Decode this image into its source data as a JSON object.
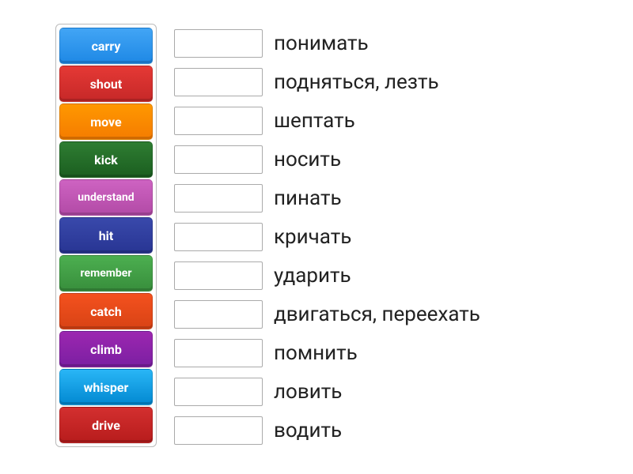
{
  "word_bank": [
    {
      "label": "carry",
      "color_class": "tile-blue-light",
      "small": false
    },
    {
      "label": "shout",
      "color_class": "tile-red",
      "small": false
    },
    {
      "label": "move",
      "color_class": "tile-orange",
      "small": false
    },
    {
      "label": "kick",
      "color_class": "tile-green",
      "small": false
    },
    {
      "label": "understand",
      "color_class": "tile-magenta",
      "small": true
    },
    {
      "label": "hit",
      "color_class": "tile-blue-dark",
      "small": false
    },
    {
      "label": "remember",
      "color_class": "tile-green-lt",
      "small": true
    },
    {
      "label": "catch",
      "color_class": "tile-orange-dk",
      "small": false
    },
    {
      "label": "climb",
      "color_class": "tile-purple",
      "small": false
    },
    {
      "label": "whisper",
      "color_class": "tile-teal-blue",
      "small": false
    },
    {
      "label": "drive",
      "color_class": "tile-red-dk",
      "small": false
    }
  ],
  "answers": [
    {
      "label": "понимать"
    },
    {
      "label": "подняться, лезть"
    },
    {
      "label": "шептать"
    },
    {
      "label": "носить"
    },
    {
      "label": "пинать"
    },
    {
      "label": "кричать"
    },
    {
      "label": "ударить"
    },
    {
      "label": "двигаться, переехать"
    },
    {
      "label": "помнить"
    },
    {
      "label": "ловить"
    },
    {
      "label": "водить"
    }
  ]
}
